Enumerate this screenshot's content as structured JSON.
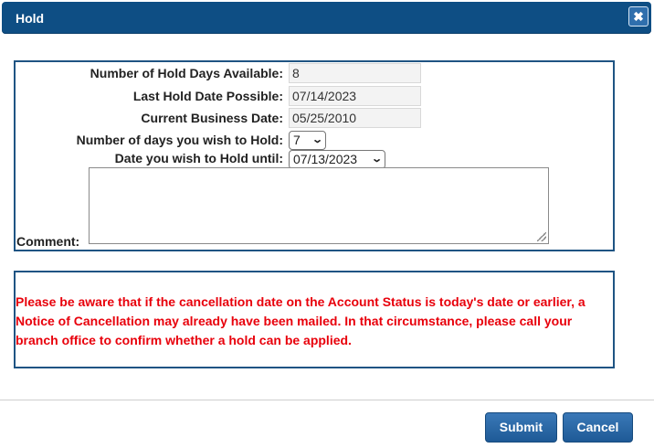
{
  "dialog": {
    "title": "Hold",
    "close_label": "✖"
  },
  "form": {
    "hold_days_available_label": "Number of Hold Days Available:",
    "hold_days_available_value": "8",
    "last_hold_date_label": "Last Hold Date Possible:",
    "last_hold_date_value": "07/14/2023",
    "current_business_date_label": "Current Business Date:",
    "current_business_date_value": "05/25/2010",
    "days_to_hold_label": "Number of days you wish to Hold:",
    "days_to_hold_selected": "7",
    "hold_until_label": "Date you wish to Hold until:",
    "hold_until_selected": "07/13/2023",
    "comment_label": "Comment:",
    "comment_value": ""
  },
  "warning": {
    "text": "Please be aware that if the cancellation date on the Account Status is today's date or earlier, a Notice of Cancellation may already have been mailed. In that circumstance, please call your branch office to confirm whether a hold can be applied.",
    "color": "#e8000b"
  },
  "buttons": {
    "submit_label": "Submit",
    "cancel_label": "Cancel"
  },
  "colors": {
    "titlebar": "#0e4e84",
    "panel_border": "#1f5483",
    "button": "#2a68a6"
  }
}
